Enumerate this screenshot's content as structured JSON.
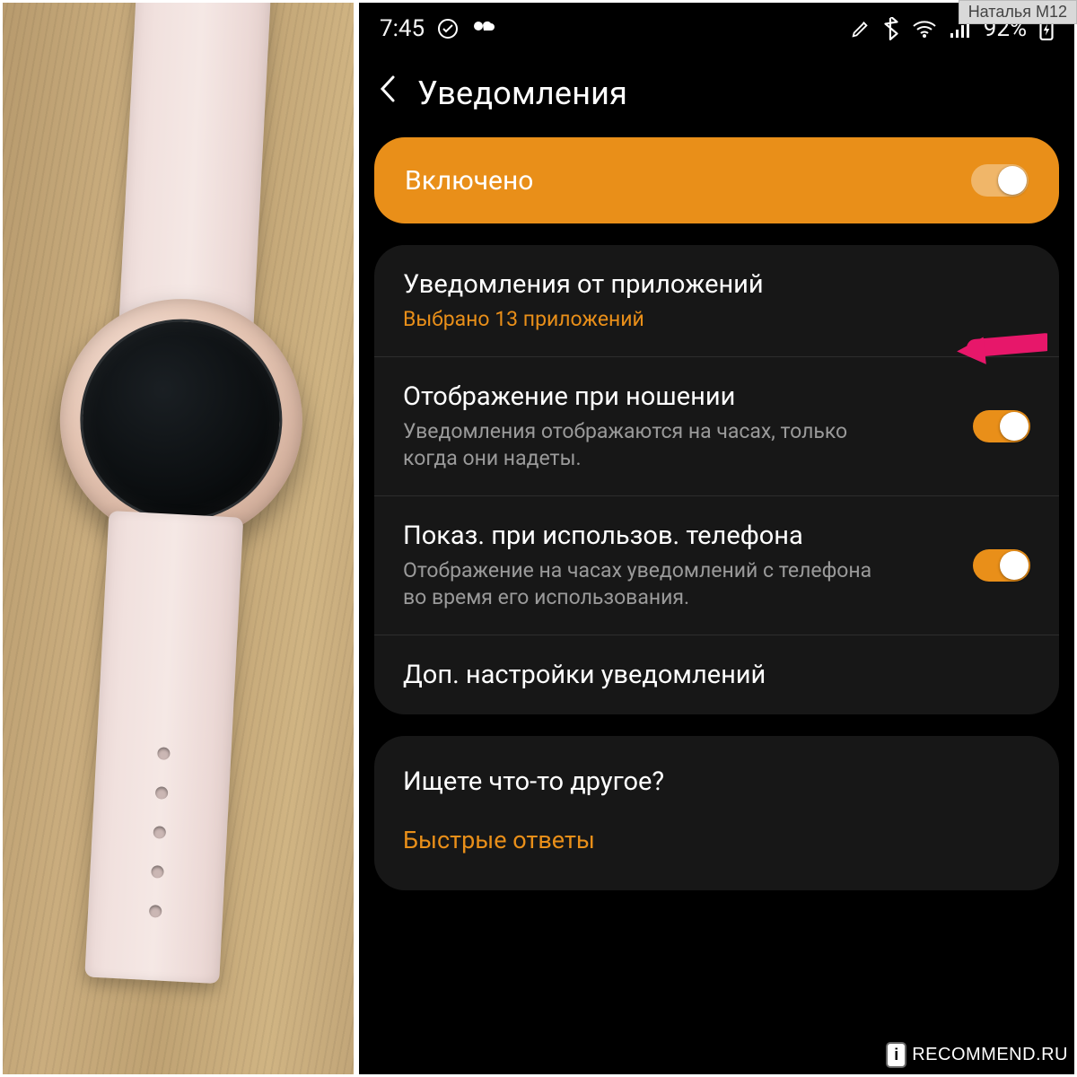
{
  "meta": {
    "user_tag": "Наталья М12",
    "watermark_badge": "i",
    "watermark_site": "RECOMMEND.RU"
  },
  "status": {
    "time": "7:45",
    "battery_text": "92%"
  },
  "header": {
    "title": "Уведомления"
  },
  "enabled_card": {
    "label": "Включено"
  },
  "section": {
    "app_notifications": {
      "title": "Уведомления от приложений",
      "subtitle": "Выбрано 13 приложений"
    },
    "wear_display": {
      "title": "Отображение при ношении",
      "subtitle": "Уведомления отображаются на часах, только когда они надеты."
    },
    "phone_use": {
      "title": "Показ. при использов. телефона",
      "subtitle": "Отображение на часах уведомлений с телефона во время его использования."
    },
    "advanced": {
      "title": "Доп. настройки уведомлений"
    }
  },
  "other": {
    "title": "Ищете что-то другое?",
    "link": "Быстрые ответы"
  },
  "colors": {
    "accent": "#e98f19",
    "annotation": "#e7176a"
  }
}
